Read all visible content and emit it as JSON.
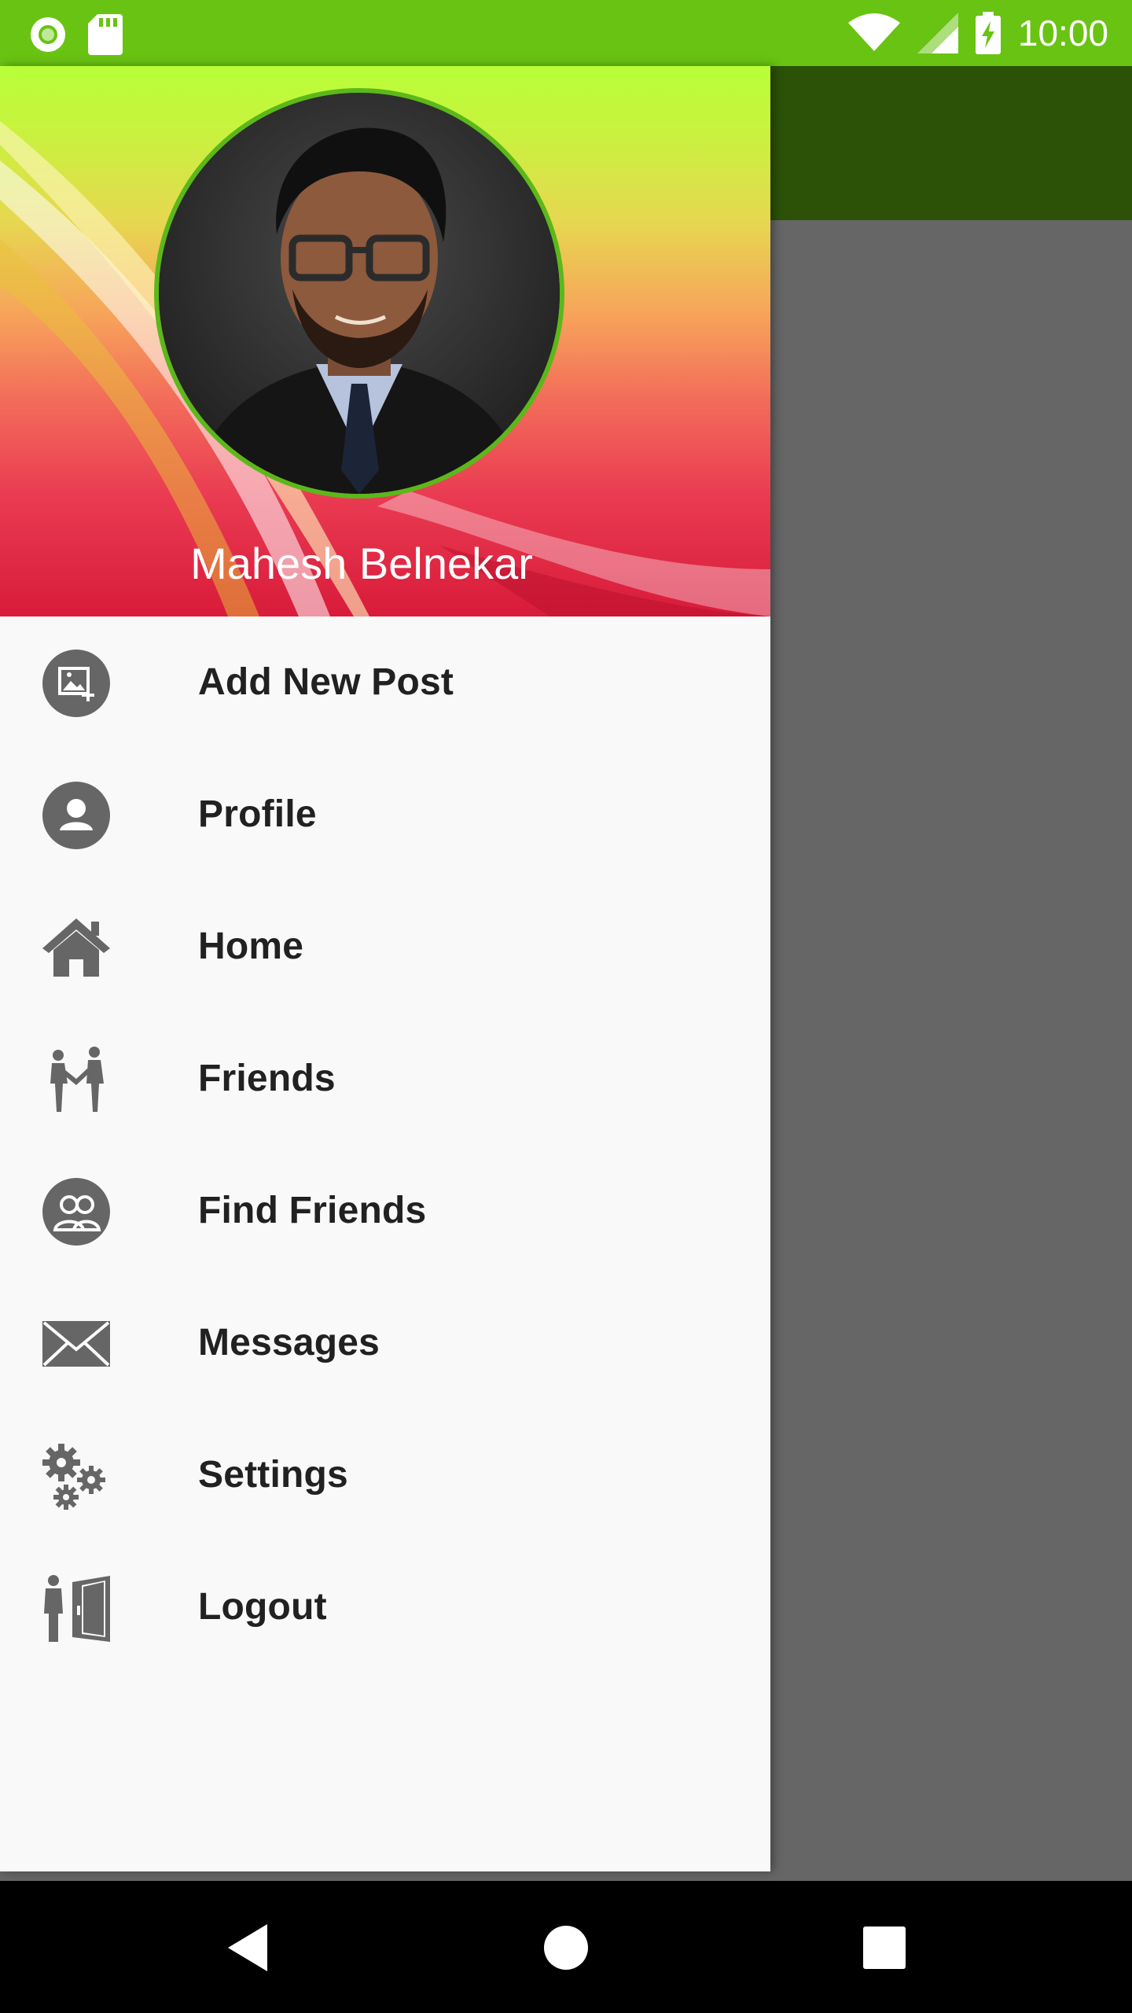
{
  "status_bar": {
    "time": "10:00",
    "icons": [
      "notification-circle-icon",
      "sd-card-icon",
      "wifi-icon",
      "cell-signal-icon",
      "battery-charging-icon"
    ],
    "background": "#69c312"
  },
  "app": {
    "toolbar_color": "#2c5208",
    "scrim_color": "#666666"
  },
  "drawer": {
    "user_name": "Mahesh Belnekar",
    "avatar_border": "#5cb81a",
    "menu": [
      {
        "label": "Add New Post",
        "icon": "add-photo-icon"
      },
      {
        "label": "Profile",
        "icon": "profile-icon"
      },
      {
        "label": "Home",
        "icon": "home-icon"
      },
      {
        "label": "Friends",
        "icon": "friends-icon"
      },
      {
        "label": "Find Friends",
        "icon": "find-friends-icon"
      },
      {
        "label": "Messages",
        "icon": "envelope-icon"
      },
      {
        "label": "Settings",
        "icon": "gears-icon"
      },
      {
        "label": "Logout",
        "icon": "logout-icon"
      }
    ],
    "icon_color": "#666666"
  },
  "nav_bar": {
    "buttons": [
      "back-icon",
      "home-circle-icon",
      "recents-square-icon"
    ]
  }
}
